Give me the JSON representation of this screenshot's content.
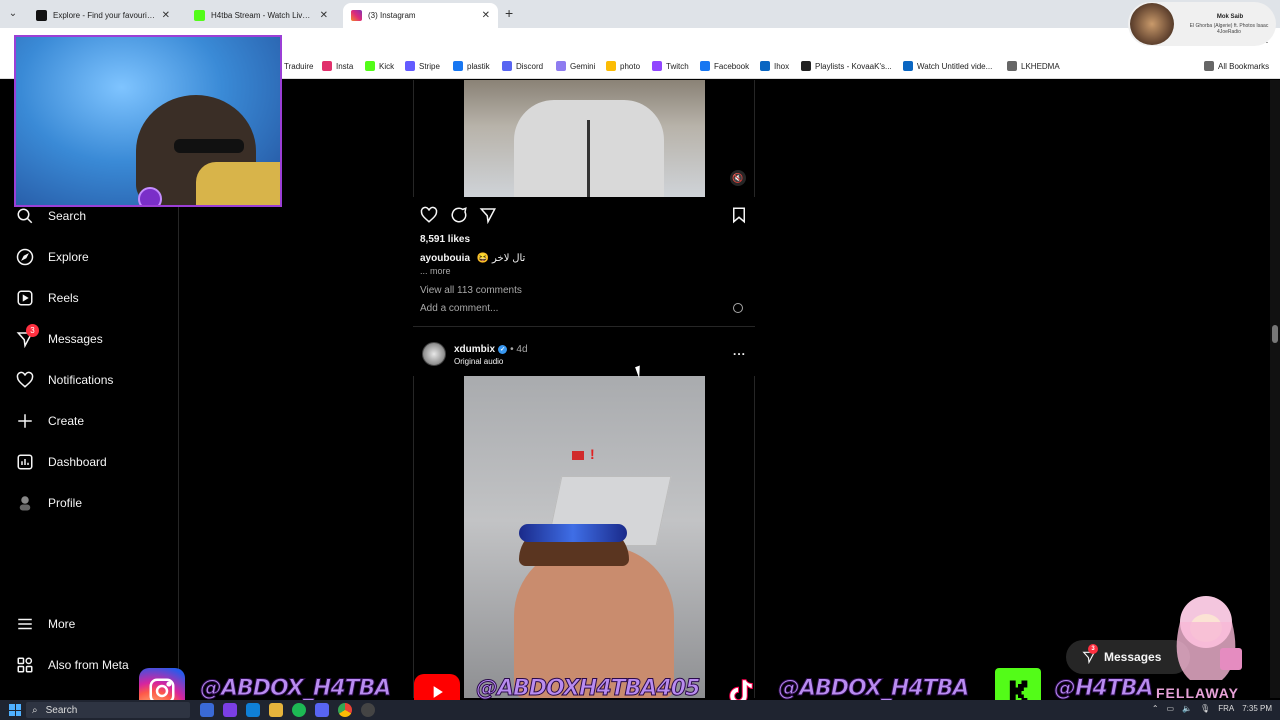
{
  "browser": {
    "tabs": [
      {
        "title": "Explore - Find your favourite vi",
        "color": "#111111"
      },
      {
        "title": "H4tba Stream - Watch Live on K",
        "color": "#53fc18"
      },
      {
        "title": "(3) Instagram",
        "color": "#e1306c"
      }
    ],
    "new_tab": "+",
    "bookmarks": [
      {
        "label": "Traduire",
        "color": "#4285f4"
      },
      {
        "label": "Insta",
        "color": "#e1306c"
      },
      {
        "label": "Kick",
        "color": "#53fc18"
      },
      {
        "label": "Stripe",
        "color": "#635bff"
      },
      {
        "label": "plastik",
        "color": "#1877f2"
      },
      {
        "label": "Discord",
        "color": "#5865f2"
      },
      {
        "label": "Gemini",
        "color": "#8e7cf0"
      },
      {
        "label": "photo",
        "color": "#fbbc05"
      },
      {
        "label": "Twitch",
        "color": "#9146ff"
      },
      {
        "label": "Facebook",
        "color": "#1877f2"
      },
      {
        "label": "Ihox",
        "color": "#0a66c2"
      },
      {
        "label": "Playlists - KovaaK's...",
        "color": "#222222"
      },
      {
        "label": "Watch Untitled vide...",
        "color": "#0a66c2"
      },
      {
        "label": "LKHEDMA",
        "color": "#666666"
      },
      {
        "label": "All Bookmarks",
        "color": "#666666"
      }
    ]
  },
  "now_playing": {
    "title": "Mok Saib",
    "subtitle": "El Ghorba (Algerie) ft. Photos Isaac 4JoeRadio"
  },
  "sidebar": {
    "items": [
      {
        "label": "Search",
        "icon": "search-icon"
      },
      {
        "label": "Explore",
        "icon": "compass-icon"
      },
      {
        "label": "Reels",
        "icon": "reels-icon"
      },
      {
        "label": "Messages",
        "icon": "messenger-icon",
        "badge": "3"
      },
      {
        "label": "Notifications",
        "icon": "heart-icon"
      },
      {
        "label": "Create",
        "icon": "plus-icon"
      },
      {
        "label": "Dashboard",
        "icon": "dashboard-icon"
      },
      {
        "label": "Profile",
        "icon": "profile-avatar-icon"
      }
    ],
    "more": "More",
    "also_from_meta": "Also from Meta"
  },
  "post1": {
    "likes": "8,591 likes",
    "username": "ayoubouia",
    "caption": "😆 تال لاخر",
    "more": "... more",
    "view_comments": "View all 113 comments",
    "add_comment_placeholder": "Add a comment..."
  },
  "post2": {
    "username": "xdumbix",
    "time": "• 4d",
    "audio": "Original audio",
    "menu": "..."
  },
  "floating_messages": {
    "label": "Messages",
    "badge": "3"
  },
  "stream_overlay": {
    "socials": [
      {
        "platform": "instagram",
        "handle": "@ABDOX_H4TBA",
        "color": "#e1306c"
      },
      {
        "platform": "youtube",
        "handle": "@ABDOXH4TBA405",
        "color": "#ff0000"
      },
      {
        "platform": "tiktok",
        "handle": "@ABDOX_H4TBA",
        "color": "#000000"
      },
      {
        "platform": "kick",
        "handle": "@H4TBA",
        "color": "#53fc18"
      }
    ],
    "brand": "FELLAWAY"
  },
  "taskbar": {
    "search": "Search",
    "language": "FRA",
    "time": "7:35 PM"
  }
}
